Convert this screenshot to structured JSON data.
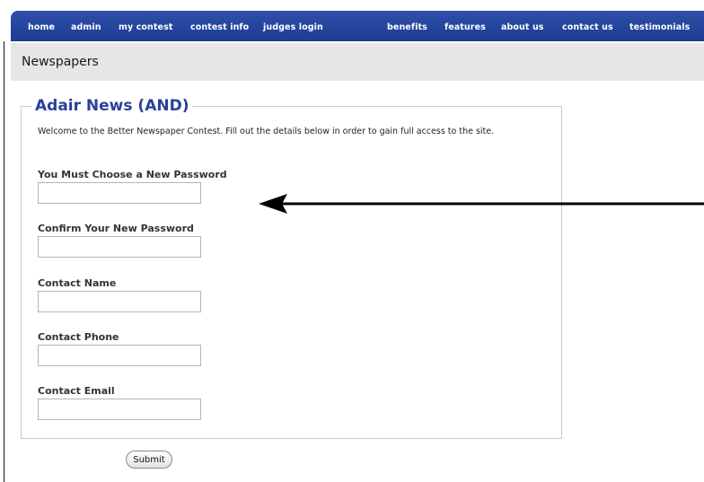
{
  "nav": {
    "left_items": [
      {
        "label": "home"
      },
      {
        "label": "admin"
      },
      {
        "label": "my contest"
      },
      {
        "label": "contest info"
      },
      {
        "label": "judges login"
      }
    ],
    "right_items": [
      {
        "label": "benefits"
      },
      {
        "label": "features"
      },
      {
        "label": "about us"
      },
      {
        "label": "contact us"
      },
      {
        "label": "testimonials"
      }
    ]
  },
  "section": {
    "title": "Newspapers"
  },
  "form": {
    "title": "Adair News (AND)",
    "intro": "Welcome to the Better Newspaper Contest. Fill out the details below in order to gain full access to the site.",
    "fields": [
      {
        "label": "You Must Choose a New Password",
        "value": ""
      },
      {
        "label": "Confirm Your New Password",
        "value": ""
      },
      {
        "label": "Contact Name",
        "value": ""
      },
      {
        "label": "Contact Phone",
        "value": ""
      },
      {
        "label": "Contact Email",
        "value": ""
      }
    ],
    "submit_label": "Submit"
  },
  "annotation": {
    "icon": "arrow-left-icon",
    "color": "#000000"
  },
  "colors": {
    "nav_background": "#1d3c94",
    "title_blue": "#2a3f9d",
    "header_gray": "#e6e6e6"
  }
}
